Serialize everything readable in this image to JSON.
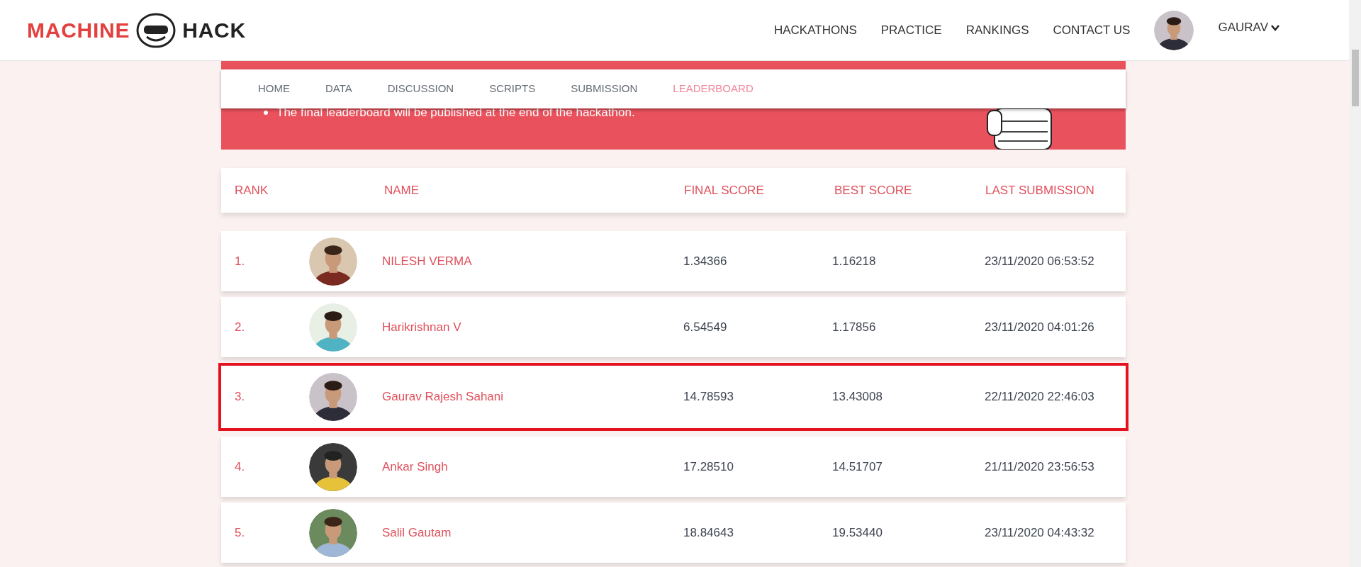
{
  "logo": {
    "left": "MACHINE",
    "right": "HACK"
  },
  "top_nav": [
    {
      "label": "HACKATHONS"
    },
    {
      "label": "PRACTICE"
    },
    {
      "label": "RANKINGS"
    },
    {
      "label": "CONTACT US"
    }
  ],
  "user": {
    "name": "GAURAV"
  },
  "banner": {
    "note": "The final leaderboard will be published at the end of the hackathon."
  },
  "tabs": [
    {
      "label": "HOME",
      "selected": false
    },
    {
      "label": "DATA",
      "selected": false
    },
    {
      "label": "DISCUSSION",
      "selected": false
    },
    {
      "label": "SCRIPTS",
      "selected": false
    },
    {
      "label": "SUBMISSION",
      "selected": false
    },
    {
      "label": "LEADERBOARD",
      "selected": true
    }
  ],
  "table": {
    "columns": [
      "RANK",
      "NAME",
      "FINAL SCORE",
      "BEST SCORE",
      "LAST SUBMISSION"
    ],
    "rows": [
      {
        "rank": "1.",
        "name": "NILESH VERMA",
        "final_score": "1.34366",
        "best_score": "1.16218",
        "last_submission": "23/11/2020 06:53:52",
        "selected": false
      },
      {
        "rank": "2.",
        "name": "Harikrishnan V",
        "final_score": "6.54549",
        "best_score": "1.17856",
        "last_submission": "23/11/2020 04:01:26",
        "selected": false
      },
      {
        "rank": "3.",
        "name": "Gaurav Rajesh Sahani",
        "final_score": "14.78593",
        "best_score": "13.43008",
        "last_submission": "22/11/2020 22:46:03",
        "selected": true
      },
      {
        "rank": "4.",
        "name": "Ankar Singh",
        "final_score": "17.28510",
        "best_score": "14.51707",
        "last_submission": "21/11/2020 23:56:53",
        "selected": false
      },
      {
        "rank": "5.",
        "name": "Salil Gautam",
        "final_score": "18.84643",
        "best_score": "19.53440",
        "last_submission": "23/11/2020 04:43:32",
        "selected": false
      }
    ]
  }
}
